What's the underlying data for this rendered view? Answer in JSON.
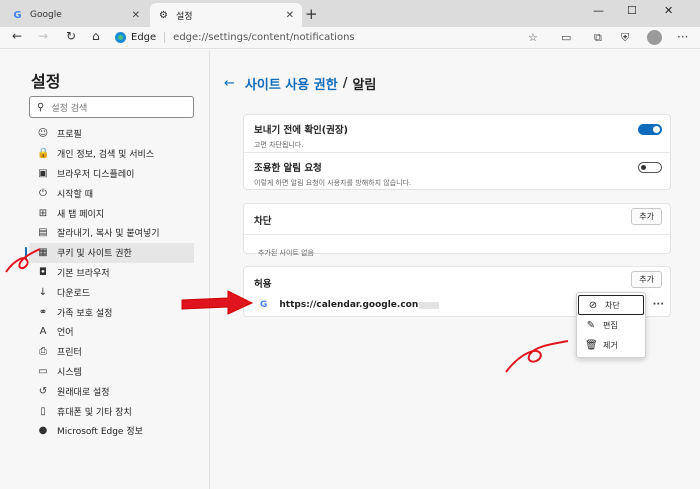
{
  "tabs": [
    {
      "label": "Google",
      "icon": "google-g-icon"
    },
    {
      "label": "설정",
      "icon": "settings-gear-icon"
    }
  ],
  "window_controls": {
    "minimize": "—",
    "maximize": "☐",
    "close": "✕"
  },
  "address_bar": {
    "brand": "Edge",
    "url": "edge://settings/content/notifications"
  },
  "sidebar": {
    "title": "설정",
    "search_placeholder": "설정 검색",
    "items": [
      {
        "label": "프로필",
        "icon": "profile-icon"
      },
      {
        "label": "개인 정보, 검색 및 서비스",
        "icon": "lock-icon"
      },
      {
        "label": "브라우저 디스플레이",
        "icon": "appearance-icon"
      },
      {
        "label": "시작할 때",
        "icon": "power-icon"
      },
      {
        "label": "새 탭 페이지",
        "icon": "new-tab-icon"
      },
      {
        "label": "잘라내기, 복사 및 붙여넣기",
        "icon": "clipboard-icon"
      },
      {
        "label": "쿠키 및 사이트 권한",
        "icon": "cookies-icon",
        "selected": true
      },
      {
        "label": "기본 브라우저",
        "icon": "browser-icon"
      },
      {
        "label": "다운로드",
        "icon": "download-icon"
      },
      {
        "label": "가족 보호 설정",
        "icon": "family-icon"
      },
      {
        "label": "언어",
        "icon": "language-icon"
      },
      {
        "label": "프린터",
        "icon": "printer-icon"
      },
      {
        "label": "시스템",
        "icon": "system-icon"
      },
      {
        "label": "원래대로 설정",
        "icon": "reset-icon"
      },
      {
        "label": "휴대폰 및 기타 장치",
        "icon": "phone-icon"
      },
      {
        "label": "Microsoft Edge 정보",
        "icon": "edge-logo-icon"
      }
    ]
  },
  "page": {
    "breadcrumb_parent": "사이트 사용 권한",
    "breadcrumb_sep": "/",
    "title": "알림"
  },
  "settings": {
    "ask_before_sending": {
      "title": "보내기 전에 확인(권장)",
      "subtitle": "고면 차단됩니다.",
      "on": true
    },
    "quiet_requests": {
      "title": "조용한 알림 요청",
      "subtitle": "이렇게 하면 알림 요청이 사용자를 방해하지 않습니다.",
      "on": false
    }
  },
  "block": {
    "title": "차단",
    "add_label": "추가",
    "empty_text": "추가된 사이트 없음"
  },
  "allow": {
    "title": "허용",
    "add_label": "추가",
    "site": "https://calendar.google.con",
    "more": "···"
  },
  "context_menu": [
    {
      "label": "차단",
      "icon": "block-icon",
      "highlighted": true
    },
    {
      "label": "편집",
      "icon": "edit-pencil-icon"
    },
    {
      "label": "제거",
      "icon": "trash-icon"
    }
  ],
  "colors": {
    "accent": "#0f6cbd",
    "annotation": "#e0141e"
  }
}
